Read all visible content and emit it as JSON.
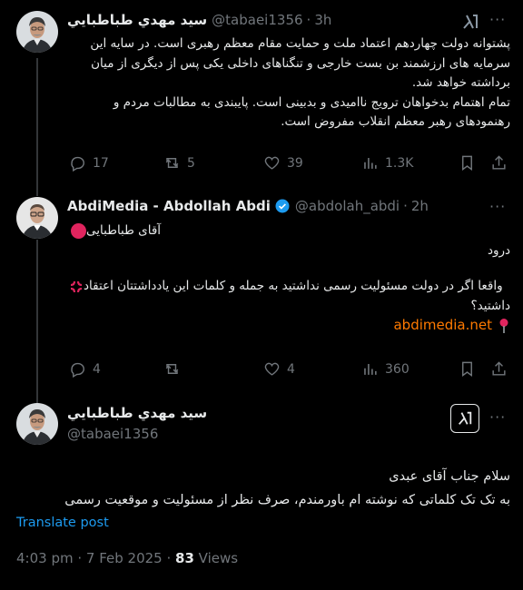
{
  "tweets": [
    {
      "display_name": "سيد مهدي طباطبايي",
      "handle": "@tabaei1356",
      "separator": "·",
      "time": "3h",
      "text_lines": [
        "پشتوانه دولت چهاردهم اعتماد ملت و حمایت مقام معظم رهبری است. در سایه این",
        "سرمایه های ارزشمند بن بست خارجی و تنگناهای داخلی یکی پس از دیگری از میان",
        "برداشته خواهد شد.",
        "تمام اهتمام بدخواهان ترویج ناامیدی و بدبینی است. پایبندی به مطالبات مردم و",
        "رهنمودهای رهبر معظم انقلاب مفروض است."
      ],
      "stats": {
        "replies": "17",
        "reposts": "5",
        "likes": "39",
        "views": "1.3K"
      }
    },
    {
      "display_name": "AbdiMedia - Abdollah Abdi",
      "handle": "@abdolah_abdi",
      "separator": "·",
      "time": "2h",
      "text_lines": [
        "آقای طباطبایی",
        "درود",
        "واقعا اگر در دولت مسئولیت رسمی نداشتید به جمله و کلمات این یادداشتتان اعتقاد",
        "داشتید؟"
      ],
      "link": "abdimedia.net",
      "stats": {
        "replies": "4",
        "reposts": "",
        "likes": "4",
        "views": "360"
      }
    }
  ],
  "main_tweet": {
    "display_name": "سيد مهدي طباطبايي",
    "handle": "@tabaei1356",
    "text_lines": [
      "سلام جناب آقای عبدی",
      "به تک تک کلماتی که نوشته ام باورمندم، صرف نظر از مسئولیت و موقعیت رسمی"
    ],
    "translate_label": "Translate post",
    "timestamp": "4:03 pm · 7 Feb 2025 · ",
    "views_count": "83",
    "views_label": " Views"
  },
  "colors": {
    "background": "#000000",
    "text": "#e7e9ea",
    "muted": "#71767b",
    "link": "#ff7a00",
    "accent": "#1d9bf0",
    "verified": "#1d9bf0",
    "red_circle": "#e0245e"
  }
}
